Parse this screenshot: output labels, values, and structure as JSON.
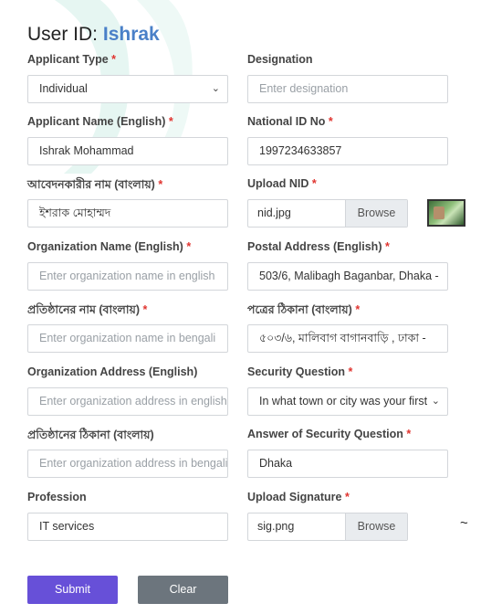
{
  "header": {
    "prefix": "User ID:",
    "user_id": "Ishrak"
  },
  "fields": {
    "applicant_type": {
      "label": "Applicant Type",
      "value": "Individual"
    },
    "designation": {
      "label": "Designation",
      "placeholder": "Enter designation"
    },
    "applicant_name_en": {
      "label": "Applicant Name (English)",
      "value": "Ishrak Mohammad"
    },
    "national_id": {
      "label": "National ID No",
      "value": "1997234633857"
    },
    "applicant_name_bn": {
      "label": "আবেদনকারীর নাম (বাংলায়)",
      "value": "ইশরাক মোহাম্মদ"
    },
    "upload_nid": {
      "label": "Upload NID",
      "file": "nid.jpg",
      "browse": "Browse"
    },
    "org_name_en": {
      "label": "Organization Name (English)",
      "placeholder": "Enter organization name in english"
    },
    "postal_address_en": {
      "label": "Postal Address (English)",
      "value": "503/6, Malibagh Baganbar, Dhaka -"
    },
    "org_name_bn": {
      "label": "প্রতিষ্ঠানের নাম (বাংলায়)",
      "placeholder": "Enter organization name in bengali"
    },
    "postal_address_bn": {
      "label": "পত্রের ঠিকানা (বাংলায়)",
      "value": "৫০৩/৬, মালিবাগ বাগানবাড়ি , ঢাকা -"
    },
    "org_address_en": {
      "label": "Organization Address (English)",
      "placeholder": "Enter organization address in english"
    },
    "security_question": {
      "label": "Security Question",
      "value": "In what town or city was your first"
    },
    "org_address_bn": {
      "label": "প্রতিষ্ঠানের ঠিকানা (বাংলায়)",
      "placeholder": "Enter organization address in bengali"
    },
    "security_answer": {
      "label": "Answer of Security Question",
      "value": "Dhaka"
    },
    "profession": {
      "label": "Profession",
      "value": "IT services"
    },
    "upload_signature": {
      "label": "Upload Signature",
      "file": "sig.png",
      "browse": "Browse"
    }
  },
  "buttons": {
    "submit": "Submit",
    "clear": "Clear"
  },
  "icons": {
    "select_chevron": "chevron-down-icon",
    "nid_preview": "nid-thumbnail",
    "signature_preview": "signature-preview"
  },
  "colors": {
    "user_id": "#4a80c8",
    "required": "#e0342f",
    "submit": "#6750d8",
    "clear": "#6c757d"
  }
}
